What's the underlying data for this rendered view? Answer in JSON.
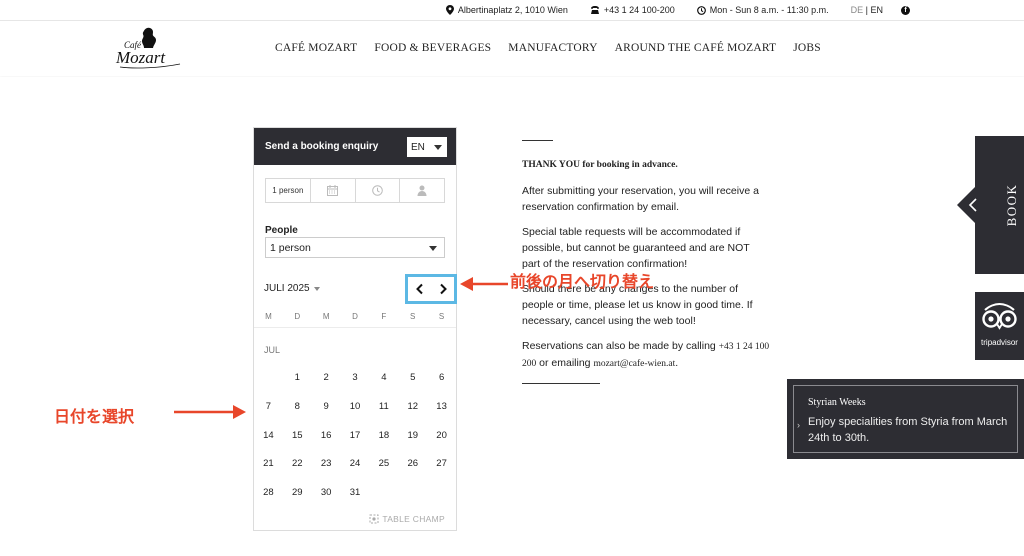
{
  "topbar": {
    "address": "Albertinaplatz 2, 1010 Wien",
    "phone": "+43 1 24 100-200",
    "hours": "Mon - Sun 8 a.m. - 11:30 p.m.",
    "lang_de": "DE",
    "lang_sep": " | ",
    "lang_en": "EN",
    "facebook_icon": "facebook-icon"
  },
  "logo": {
    "line1": "Café",
    "line2": "Mozart"
  },
  "nav": [
    "CAFÉ MOZART",
    "FOOD & BEVERAGES",
    "MANUFACTORY",
    "AROUND THE CAFÉ MOZART",
    "JOBS"
  ],
  "widget": {
    "title": "Send a booking enquiry",
    "language": "EN",
    "steps": {
      "people": "1 person",
      "date_icon": "calendar-icon",
      "time_icon": "clock-icon",
      "guest_icon": "person-icon"
    },
    "people_label": "People",
    "people_value": "1 person",
    "month_label": "JULI 2025",
    "weekdays": [
      "M",
      "D",
      "M",
      "D",
      "F",
      "S",
      "S"
    ],
    "month_tag": "JUL",
    "weeks": [
      [
        "",
        "1",
        "2",
        "3",
        "4",
        "5",
        "6"
      ],
      [
        "7",
        "8",
        "9",
        "10",
        "11",
        "12",
        "13"
      ],
      [
        "14",
        "15",
        "16",
        "17",
        "18",
        "19",
        "20"
      ],
      [
        "21",
        "22",
        "23",
        "24",
        "25",
        "26",
        "27"
      ],
      [
        "28",
        "29",
        "30",
        "31",
        "",
        "",
        ""
      ]
    ],
    "powered_by": "TABLE CHAMP"
  },
  "info": {
    "thank_you": "THANK YOU for booking in advance.",
    "p1": "After submitting your reservation, you will receive a reservation confirmation by email.",
    "p2": "Special table requests will be accommodated if possible, but cannot be guaranteed and are NOT part of the reservation confirmation!",
    "p3": "Should there be any changes to the number of people or time, please let us know in good time. If necessary, cancel using the web tool!",
    "p4_prefix": "Reservations can also be made by calling ",
    "p4_phone": "+43 1 24 100 200",
    "p4_mid": " or emailing ",
    "p4_email": "mozart@cafe-wien.at",
    "p4_suffix": "."
  },
  "annotations": {
    "nav_hint": "前後の月へ切り替え",
    "date_hint": "日付を選択",
    "color": "#e8462a"
  },
  "side": {
    "book_label": "BOOK",
    "tripadvisor_label": "tripadvisor"
  },
  "promo": {
    "title": "Styrian Weeks",
    "body": "Enjoy specialities from Styria from March 24th to 30th."
  },
  "colors": {
    "dark": "#2d2d33",
    "highlight": "#5cb8e4"
  }
}
